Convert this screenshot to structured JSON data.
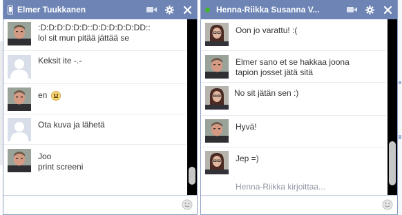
{
  "colors": {
    "header_bg": "#6d84b4",
    "border": "#8b9dc3",
    "online": "#42b72a",
    "scrollbar_track": "#000000",
    "scrollbar_thumb": "#c7c7c7"
  },
  "chats": [
    {
      "name": "Elmer Tuukkanen",
      "status_icon": "mobile-phone-icon",
      "header_icons": [
        "video-camera-icon",
        "gear-icon",
        "close-icon"
      ],
      "messages": [
        {
          "sender": "Elmer",
          "avatar": "man-avatar",
          "lines": [
            ":D:D:D:D:D:D::D:D:D:D:D:DD::",
            "lol sit mun pitää jättää se"
          ]
        },
        {
          "sender": "me",
          "avatar": "default-avatar",
          "lines": [
            "Keksit ite -.-"
          ]
        },
        {
          "sender": "Elmer",
          "avatar": "man-avatar",
          "lines": [
            "en"
          ],
          "emoticon": "grimace-emoticon"
        },
        {
          "sender": "me",
          "avatar": "default-avatar",
          "lines": [
            "Ota kuva ja lähetä"
          ]
        },
        {
          "sender": "Elmer",
          "avatar": "man-avatar",
          "lines": [
            "Joo",
            "print screeni"
          ]
        }
      ],
      "input_value": "",
      "emoji_icon": "smiley-icon"
    },
    {
      "name": "Henna-Riikka Susanna V...",
      "status_icon": "online-dot",
      "header_icons": [
        "video-camera-icon",
        "gear-icon",
        "close-icon"
      ],
      "messages": [
        {
          "sender": "Henna",
          "avatar": "woman-avatar",
          "lines": [
            "Oon jo varattu! :("
          ]
        },
        {
          "sender": "Elmer",
          "avatar": "man-avatar",
          "lines": [
            "Elmer sano et se hakkaa joona",
            "tapion josset jätä sitä"
          ]
        },
        {
          "sender": "Henna",
          "avatar": "woman-avatar",
          "lines": [
            "No sit jätän sen :)"
          ]
        },
        {
          "sender": "Elmer",
          "avatar": "man-avatar",
          "lines": [
            "Hyvä!"
          ]
        },
        {
          "sender": "Henna",
          "avatar": "woman-avatar",
          "lines": [
            "Jep =)"
          ]
        }
      ],
      "typing_indicator": "Henna-Riikka kirjoittaa...",
      "input_value": "",
      "emoji_icon": "smiley-icon"
    }
  ]
}
